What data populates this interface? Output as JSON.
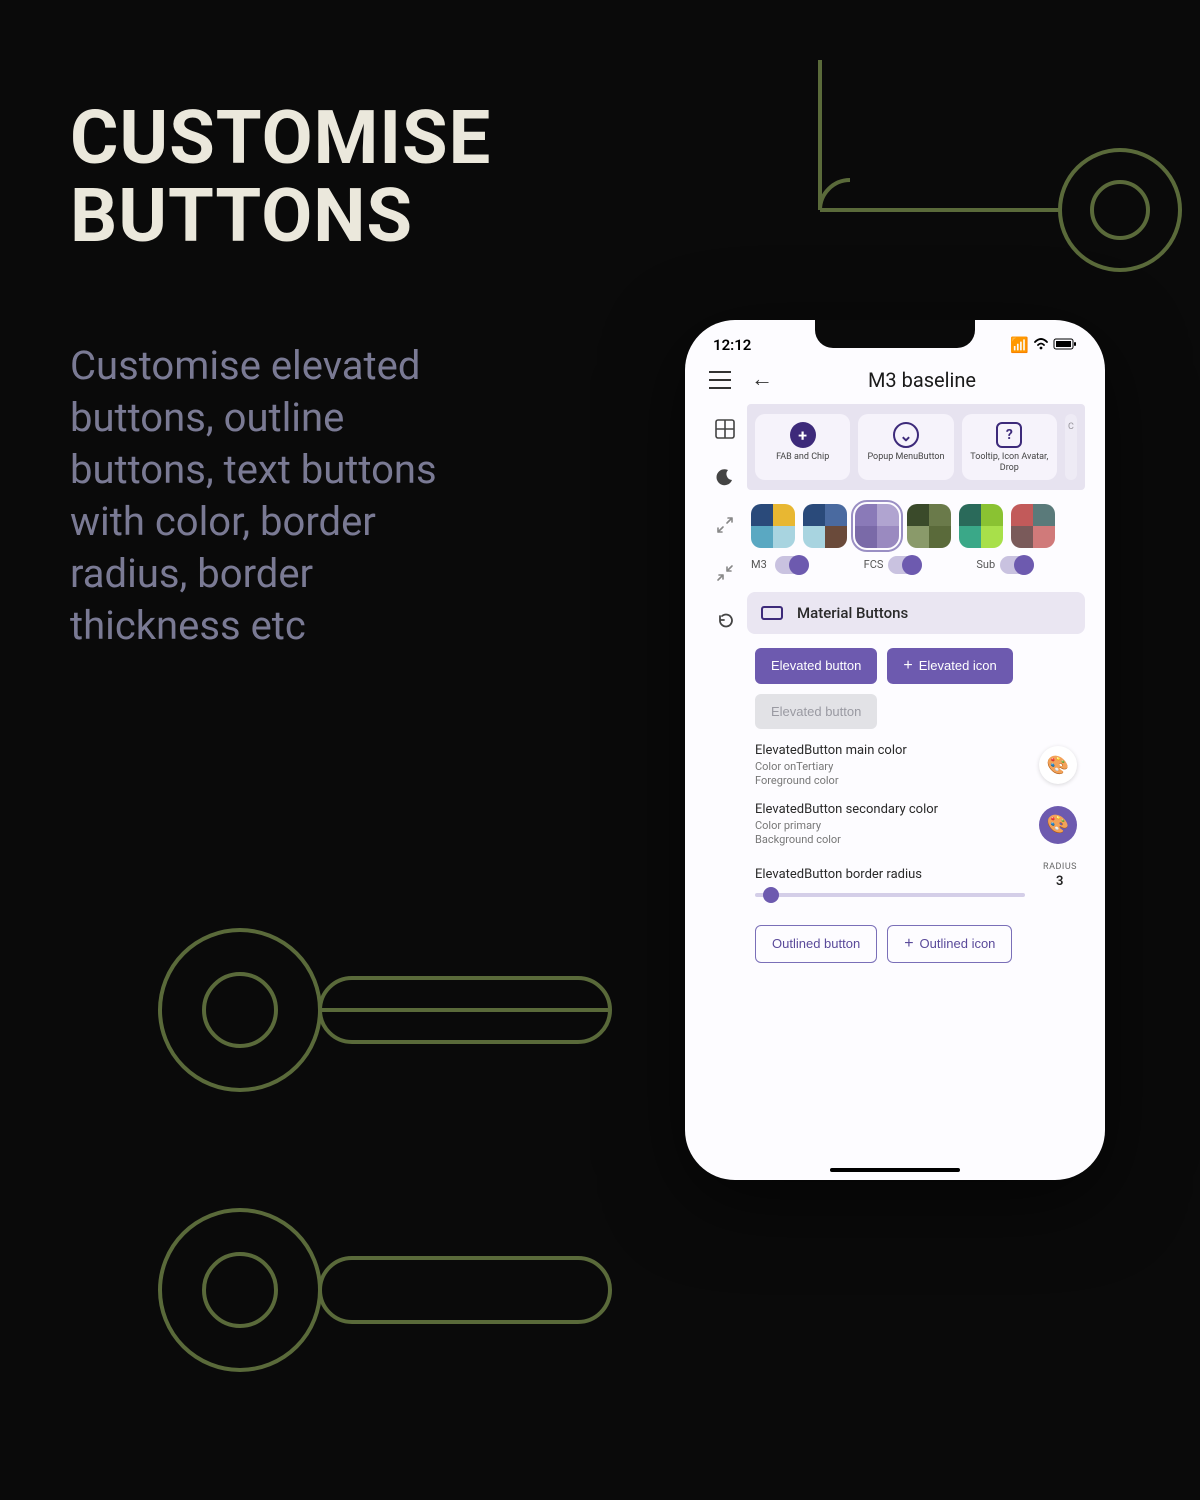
{
  "heading": "CUSTOMISE\nBUTTONS",
  "subcopy": "Customise elevated buttons, outline buttons, text buttons with color, border radius, border thickness etc",
  "statusbar": {
    "time": "12:12"
  },
  "appbar": {
    "title": "M3 baseline"
  },
  "chips": [
    {
      "icon": "+",
      "style": "filled",
      "label": "FAB and Chip"
    },
    {
      "icon": "⌄",
      "style": "outline",
      "label": "Popup MenuButton"
    },
    {
      "icon": "?",
      "style": "square",
      "label": "Tooltip, Icon Avatar, Drop"
    },
    {
      "icon": "",
      "style": "partial",
      "label": "C"
    }
  ],
  "palettes": [
    {
      "c": [
        "#2a4a7a",
        "#e8b732",
        "#5aa8c2",
        "#a8d4e0"
      ],
      "sel": false
    },
    {
      "c": [
        "#2a4a7a",
        "#4a6aa0",
        "#a8d4e0",
        "#6a4a3a"
      ],
      "sel": false
    },
    {
      "c": [
        "#8a7ab8",
        "#b0a4d0",
        "#7a6aa8",
        "#9a8ac0"
      ],
      "sel": true
    },
    {
      "c": [
        "#3a4a2a",
        "#6a7a4a",
        "#8a9a6a",
        "#5a6a3a"
      ],
      "sel": false
    },
    {
      "c": [
        "#2a6a5a",
        "#8ac232",
        "#3aa888",
        "#a8e04a"
      ],
      "sel": false
    },
    {
      "c": [
        "#c25a5a",
        "#5a7a7a",
        "#7a5a5a",
        "#d07a7a"
      ],
      "sel": false
    }
  ],
  "toggles": [
    {
      "label": "M3"
    },
    {
      "label": "FCS"
    },
    {
      "label": "Sub"
    }
  ],
  "section": {
    "title": "Material Buttons"
  },
  "buttons": {
    "elevated": "Elevated button",
    "elevated_icon": "Elevated icon",
    "elevated_disabled": "Elevated button",
    "outlined": "Outlined button",
    "outlined_icon": "Outlined icon"
  },
  "props": {
    "main_color": {
      "title": "ElevatedButton main color",
      "sub1": "Color onTertiary",
      "sub2": "Foreground color"
    },
    "secondary_color": {
      "title": "ElevatedButton secondary color",
      "sub1": "Color primary",
      "sub2": "Background color"
    },
    "radius": {
      "title": "ElevatedButton border radius",
      "meta": "RADIUS",
      "value": "3"
    }
  }
}
